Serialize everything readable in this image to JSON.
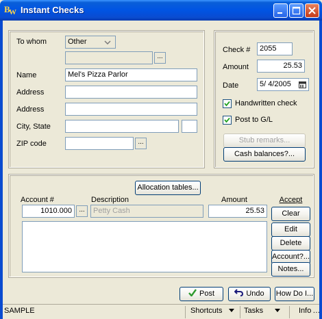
{
  "window": {
    "title": "Instant Checks",
    "icon_b": "B",
    "icon_w": "W"
  },
  "payee": {
    "to_whom_label": "To whom",
    "to_whom_value": "Other",
    "name_label": "Name",
    "name_value": "Mel's Pizza Parlor",
    "address1_label": "Address",
    "address2_label": "Address",
    "city_state_label": "City, State",
    "zip_label": "ZIP code",
    "browse_label": "..."
  },
  "check": {
    "number_label": "Check #",
    "number_value": "2055",
    "amount_label": "Amount",
    "amount_value": "25.53",
    "date_label": "Date",
    "date_value": "5/ 4/2005",
    "handwritten_label": "Handwritten check",
    "handwritten_checked": true,
    "post_gl_label": "Post to G/L",
    "post_gl_checked": true,
    "stub_remarks_label": "Stub remarks...",
    "cash_balances_label": "Cash balances?..."
  },
  "allocation": {
    "tables_button": "Allocation tables...",
    "account_header": "Account #",
    "description_header": "Description",
    "amount_header": "Amount",
    "account_value": "1010.000",
    "description_value": "Petty Cash",
    "amount_value": "25.53",
    "browse_label": "...",
    "accept_label": "Accept",
    "clear_label": "Clear",
    "edit_label": "Edit",
    "delete_label": "Delete",
    "account_button_label": "Account?...",
    "notes_label": "Notes..."
  },
  "actions": {
    "post_label": "Post",
    "undo_label": "Undo",
    "how_do_i_label": "How Do I..."
  },
  "status": {
    "left": "SAMPLE",
    "shortcuts": "Shortcuts",
    "tasks": "Tasks",
    "info": "Info"
  },
  "colors": {
    "titlebar": "#0054e3",
    "dialog": "#ece9d8",
    "post_check": "#2e9a2e",
    "undo_arrow": "#1a1a7a"
  }
}
